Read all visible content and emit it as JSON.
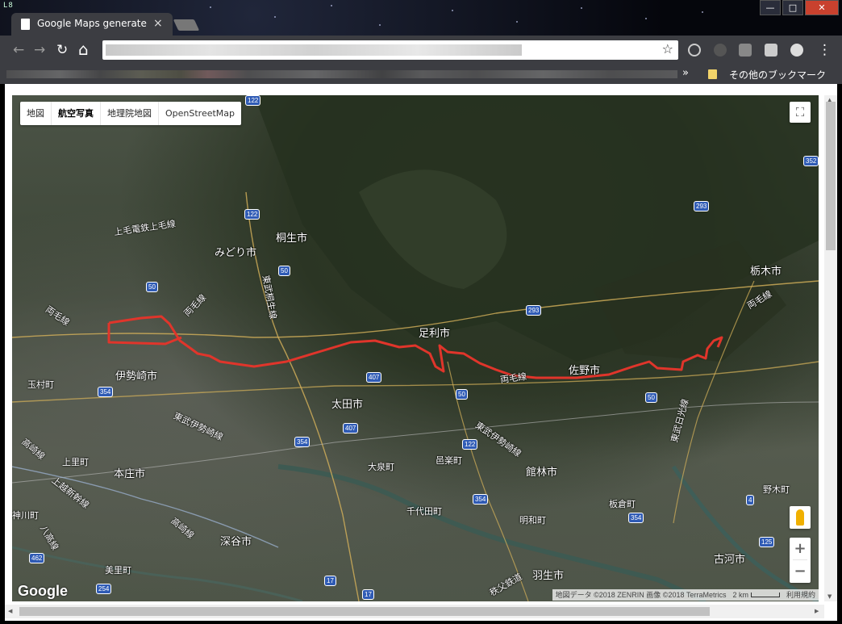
{
  "browser": {
    "tab_title": "Google Maps generate",
    "tab_close": "×",
    "app_mark": "L8",
    "bookmark_more": "»",
    "other_bookmarks": "その他のブックマーク",
    "window_buttons": {
      "minimize": "—",
      "maximize": "□",
      "close": "✕"
    },
    "nav": {
      "back": "←",
      "forward": "→",
      "reload": "↻",
      "home": "⌂",
      "star": "☆",
      "menu": "⋮"
    }
  },
  "map": {
    "map_type_buttons": [
      "地図",
      "航空写真",
      "地理院地図",
      "OpenStreetMap"
    ],
    "active_map_type": "航空写真",
    "fullscreen_icon": "⛶",
    "zoom_in": "+",
    "zoom_out": "−",
    "google_logo": "Google",
    "attribution": "地図データ ©2018 ZENRIN 画像 ©2018 TerraMetrics",
    "scale": "2 km",
    "terms": "利用規約",
    "route_color": "#e0352b",
    "labels": {
      "kiryu": "桐生市",
      "midori": "みどり市",
      "ashikaga": "足利市",
      "sano": "佐野市",
      "tochigi": "栃木市",
      "isesaki": "伊勢崎市",
      "ota": "太田市",
      "tatebayashi": "館林市",
      "honjo": "本庄市",
      "fukaya": "深谷市",
      "koga": "古河市",
      "hanyu": "羽生市",
      "tamamura": "玉村町",
      "kamisato": "上里町",
      "kamikawa": "神川町",
      "misato": "美里町",
      "oizumi": "大泉町",
      "ora": "邑楽町",
      "chiyoda": "千代田町",
      "meiwa": "明和町",
      "itakura": "板倉町",
      "nogi": "野木町",
      "line_jomo": "上毛電鉄上毛線",
      "line_ryomo_w": "両毛線",
      "line_ryomo_mid": "両毛線",
      "line_ryomo_c": "両毛線",
      "line_ryomo_e": "両毛線",
      "line_tobu_kiryu": "東武桐生線",
      "line_tobu_isesaki_w": "東武伊勢崎線",
      "line_tobu_isesaki_e": "東武伊勢崎線",
      "line_takasaki": "高崎線",
      "line_takasaki_s": "高崎線",
      "line_joetsu": "上越新幹線",
      "line_hachiko": "八高線",
      "line_tobu_nikko": "東武日光線",
      "line_chichibu": "秩父鉄道"
    },
    "shields": {
      "r122_top": "122",
      "r122_kiryu": "122",
      "r122_s": "122",
      "r50_a": "50",
      "r50_b": "50",
      "r50_c": "50",
      "r50_d": "50",
      "r352": "352",
      "r293_a": "293",
      "r293_b": "293",
      "r407_a": "407",
      "r407_b": "407",
      "r354_a": "354",
      "r354_b": "354",
      "r354_c": "354",
      "r354_d": "354",
      "r125": "125",
      "r4": "4",
      "r462": "462",
      "r17_a": "17",
      "r17_b": "17",
      "r254": "254"
    }
  }
}
